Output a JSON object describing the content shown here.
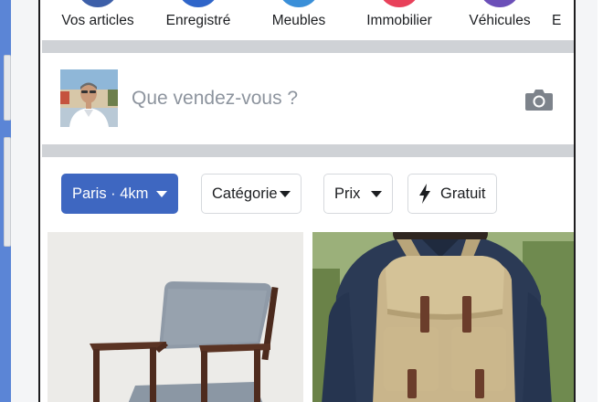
{
  "categories": [
    {
      "label": "Vos articles",
      "color": "#3d5fa8"
    },
    {
      "label": "Enregistré",
      "color": "#2f65c9"
    },
    {
      "label": "Meubles",
      "color": "#3a8fd8"
    },
    {
      "label": "Immobilier",
      "color": "#e8415a"
    },
    {
      "label": "Véhicules",
      "color": "#6b4fb8"
    },
    {
      "label": "E",
      "color": "#f0f0f0"
    }
  ],
  "composer": {
    "placeholder": "Que vendez-vous ?",
    "avatar_icon": "user-avatar",
    "camera_icon": "camera-icon"
  },
  "filters": [
    {
      "label": "Paris · 4km",
      "active": true,
      "has_caret": true
    },
    {
      "label": "Catégorie",
      "active": false,
      "has_caret": true
    },
    {
      "label": "Prix",
      "active": false,
      "has_caret": true
    },
    {
      "label": "Gratuit",
      "active": false,
      "icon": "bolt-icon"
    }
  ],
  "colors": {
    "accent": "#3e67c1",
    "separator": "#cfd2d6",
    "placeholder_text": "#8d949e"
  },
  "products": [
    {
      "image": "armchair-photo"
    },
    {
      "image": "backpack-photo"
    }
  ]
}
